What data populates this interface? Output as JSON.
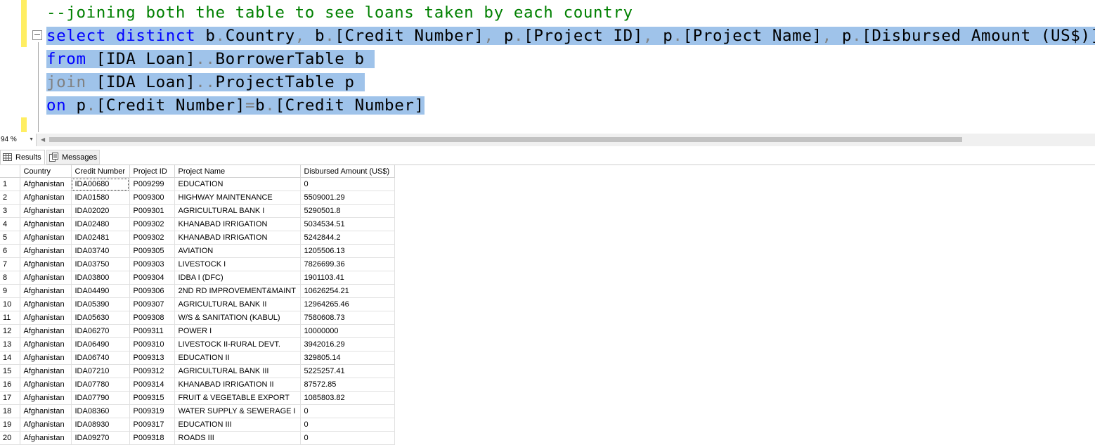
{
  "editor": {
    "comment_line": "--joining both the table to see loans taken by each country",
    "line1": {
      "kw1": "select",
      "kw2": "distinct",
      "a1": "b",
      "c1": "Country",
      "a2": "b",
      "c2": "[Credit Number]",
      "a3": "p",
      "c3": "[Project ID]",
      "a4": "p",
      "c4": "[Project Name]",
      "a5": "p",
      "c5": "[Disbursed Amount (US$)]"
    },
    "line2": {
      "kw": "from",
      "db": "[IDA Loan]",
      "tbl": "BorrowerTable b"
    },
    "line3": {
      "kw": "join",
      "db": "[IDA Loan]",
      "tbl": "ProjectTable p"
    },
    "line4": {
      "kw": "on",
      "left": "p",
      "leftcol": "[Credit Number]",
      "right": "b",
      "rightcol": "[Credit Number]"
    }
  },
  "statusbar": {
    "zoom": "94 %"
  },
  "tabs": {
    "results": "Results",
    "messages": "Messages"
  },
  "grid": {
    "columns": [
      "Country",
      "Credit Number",
      "Project ID",
      "Project Name",
      "Disbursed Amount (US$)"
    ],
    "rows": [
      [
        "1",
        "Afghanistan",
        "IDA00680",
        "P009299",
        "EDUCATION",
        "0"
      ],
      [
        "2",
        "Afghanistan",
        "IDA01580",
        "P009300",
        "HIGHWAY MAINTENANCE",
        "5509001.29"
      ],
      [
        "3",
        "Afghanistan",
        "IDA02020",
        "P009301",
        "AGRICULTURAL BANK I",
        "5290501.8"
      ],
      [
        "4",
        "Afghanistan",
        "IDA02480",
        "P009302",
        "KHANABAD IRRIGATION",
        "5034534.51"
      ],
      [
        "5",
        "Afghanistan",
        "IDA02481",
        "P009302",
        "KHANABAD IRRIGATION",
        "5242844.2"
      ],
      [
        "6",
        "Afghanistan",
        "IDA03740",
        "P009305",
        "AVIATION",
        "1205506.13"
      ],
      [
        "7",
        "Afghanistan",
        "IDA03750",
        "P009303",
        "LIVESTOCK I",
        "7826699.36"
      ],
      [
        "8",
        "Afghanistan",
        "IDA03800",
        "P009304",
        "IDBA I (DFC)",
        "1901103.41"
      ],
      [
        "9",
        "Afghanistan",
        "IDA04490",
        "P009306",
        "2ND RD IMPROVEMENT&MAINT",
        "10626254.21"
      ],
      [
        "10",
        "Afghanistan",
        "IDA05390",
        "P009307",
        "AGRICULTURAL BANK II",
        "12964265.46"
      ],
      [
        "11",
        "Afghanistan",
        "IDA05630",
        "P009308",
        "W/S & SANITATION (KABUL)",
        "7580608.73"
      ],
      [
        "12",
        "Afghanistan",
        "IDA06270",
        "P009311",
        "POWER I",
        "10000000"
      ],
      [
        "13",
        "Afghanistan",
        "IDA06490",
        "P009310",
        "LIVESTOCK II-RURAL DEVT.",
        "3942016.29"
      ],
      [
        "14",
        "Afghanistan",
        "IDA06740",
        "P009313",
        "EDUCATION II",
        "329805.14"
      ],
      [
        "15",
        "Afghanistan",
        "IDA07210",
        "P009312",
        "AGRICULTURAL BANK III",
        "5225257.41"
      ],
      [
        "16",
        "Afghanistan",
        "IDA07780",
        "P009314",
        "KHANABAD IRRIGATION II",
        "87572.85"
      ],
      [
        "17",
        "Afghanistan",
        "IDA07790",
        "P009315",
        "FRUIT & VEGETABLE EXPORT",
        "1085803.82"
      ],
      [
        "18",
        "Afghanistan",
        "IDA08360",
        "P009319",
        "WATER SUPPLY & SEWERAGE I",
        "0"
      ],
      [
        "19",
        "Afghanistan",
        "IDA08930",
        "P009317",
        "EDUCATION III",
        "0"
      ],
      [
        "20",
        "Afghanistan",
        "IDA09270",
        "P009318",
        "ROADS III",
        "0"
      ]
    ]
  }
}
